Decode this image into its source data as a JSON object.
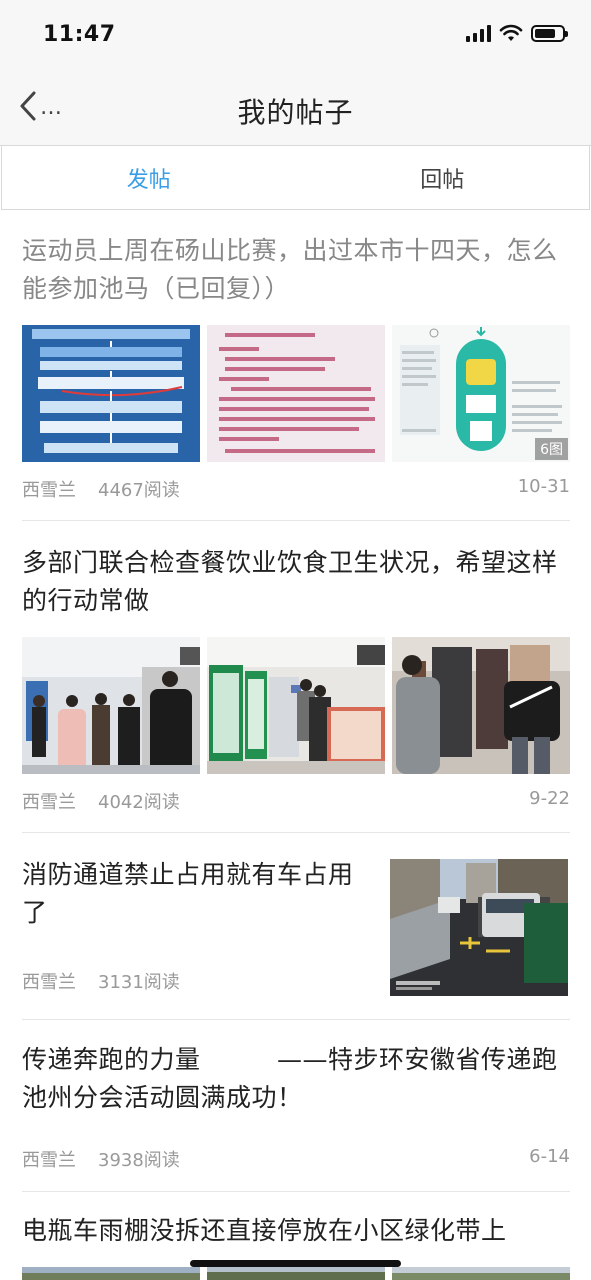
{
  "status": {
    "time": "11:47"
  },
  "nav": {
    "back_dots": "…",
    "title": "我的帖子"
  },
  "tabs": [
    {
      "label": "发帖",
      "active": true
    },
    {
      "label": "回帖",
      "active": false
    }
  ],
  "posts": [
    {
      "title": "运动员上周在砀山比赛，出过本市十四天，怎么能参加池马（已回复））",
      "author": "西雪兰",
      "reads": "4467阅读",
      "date": "10-31",
      "image_count": "6图"
    },
    {
      "title": "多部门联合检查餐饮业饮食卫生状况，希望这样的行动常做",
      "author": "西雪兰",
      "reads": "4042阅读",
      "date": "9-22"
    },
    {
      "title": "消防通道禁止占用就有车占用了",
      "author": "西雪兰",
      "reads": "3131阅读",
      "date": ""
    },
    {
      "title": "传递奔跑的力量　　　——特步环安徽省传递跑池州分会活动圆满成功！",
      "author": "西雪兰",
      "reads": "3938阅读",
      "date": "6-14"
    },
    {
      "title": "电瓶车雨棚没拆还直接停放在小区绿化带上",
      "author": "",
      "reads": "",
      "date": ""
    }
  ],
  "colors": {
    "accent": "#3a9ee6",
    "meta": "#999999",
    "read_title": "#888888"
  }
}
